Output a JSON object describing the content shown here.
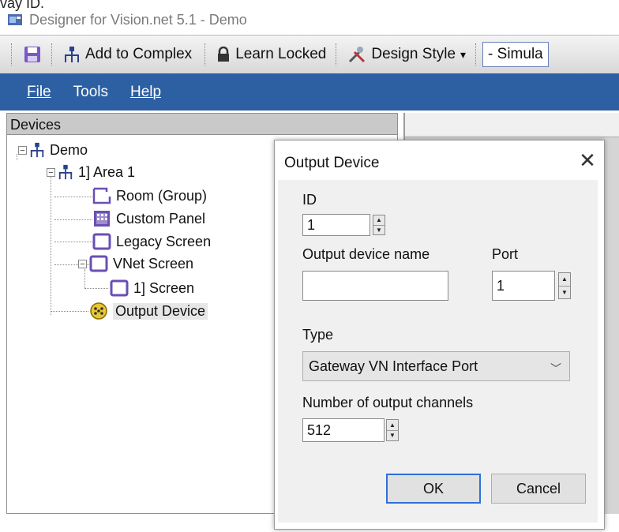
{
  "cut_text": "vay ID.",
  "app": {
    "title": "Designer for Vision.net 5.1 - Demo"
  },
  "toolbar": {
    "add_to_complex": "Add to Complex",
    "learn_locked": "Learn Locked",
    "design_style": "Design Style",
    "design_style_arrow": "▾",
    "simulate": "- Simula"
  },
  "menu": {
    "file": "File",
    "tools": "Tools",
    "help": "Help"
  },
  "devices": {
    "header": "Devices",
    "tree": {
      "demo": "Demo",
      "area1": "1] Area 1",
      "room_group": "Room (Group)",
      "custom_panel": "Custom Panel",
      "legacy_screen": "Legacy Screen",
      "vnet_screen": "VNet Screen",
      "screen1": "1] Screen",
      "output_device": "Output Device"
    }
  },
  "dialog": {
    "title": "Output Device",
    "close": "✕",
    "id_label": "ID",
    "id_value": "1",
    "name_label": "Output device name",
    "name_value": "",
    "port_label": "Port",
    "port_value": "1",
    "type_label": "Type",
    "type_value": "Gateway VN Interface Port",
    "channels_label": "Number of output channels",
    "channels_value": "512",
    "ok": "OK",
    "cancel": "Cancel"
  },
  "colors": {
    "menubar": "#2d5fa3",
    "tree_icon": "#6a4fb3",
    "ok_border": "#2e6fd8"
  },
  "icons": [
    "save-icon",
    "hierarchy-icon",
    "lock-icon",
    "tools-icon",
    "room-group-icon",
    "custom-panel-icon",
    "screen-icon",
    "output-device-icon",
    "close-icon",
    "chevron-down-icon"
  ]
}
